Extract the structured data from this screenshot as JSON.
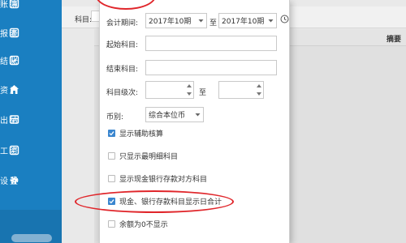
{
  "sidebar": {
    "items": [
      {
        "label": "账簿",
        "icon": "ledger-icon"
      },
      {
        "label": "报表",
        "icon": "report-icon"
      },
      {
        "label": "结账",
        "icon": "close-account-icon"
      },
      {
        "label": "资产",
        "icon": "house-icon"
      },
      {
        "label": "出纳",
        "icon": "cashier-icon"
      },
      {
        "label": "工资",
        "icon": "salary-icon"
      },
      {
        "label": "设置",
        "icon": "gear-icon"
      }
    ],
    "bg_color": "#1a7fc1"
  },
  "main": {
    "filter_label": "科目:",
    "column_header": "摘要"
  },
  "popup": {
    "period_label": "会计期间:",
    "period_from": "2017年10期",
    "period_to_sep": "至",
    "period_to": "2017年10期",
    "start_subject_label": "起始科目:",
    "end_subject_label": "结束科目:",
    "level_label": "科目级次:",
    "level_to_sep": "至",
    "currency_label": "币别:",
    "currency_value": "综合本位币",
    "options": [
      {
        "label": "显示辅助核算",
        "checked": true
      },
      {
        "label": "只显示最明细科目",
        "checked": false
      },
      {
        "label": "显示现金银行存款对方科目",
        "checked": false
      },
      {
        "label": "现金、银行存款科目显示日合计",
        "checked": true
      },
      {
        "label": "余额为0不显示",
        "checked": false
      }
    ]
  },
  "colors": {
    "accent": "#1a7fc1",
    "checkbox_checked": "#3a86cf",
    "annotation_red": "#e0262b"
  }
}
